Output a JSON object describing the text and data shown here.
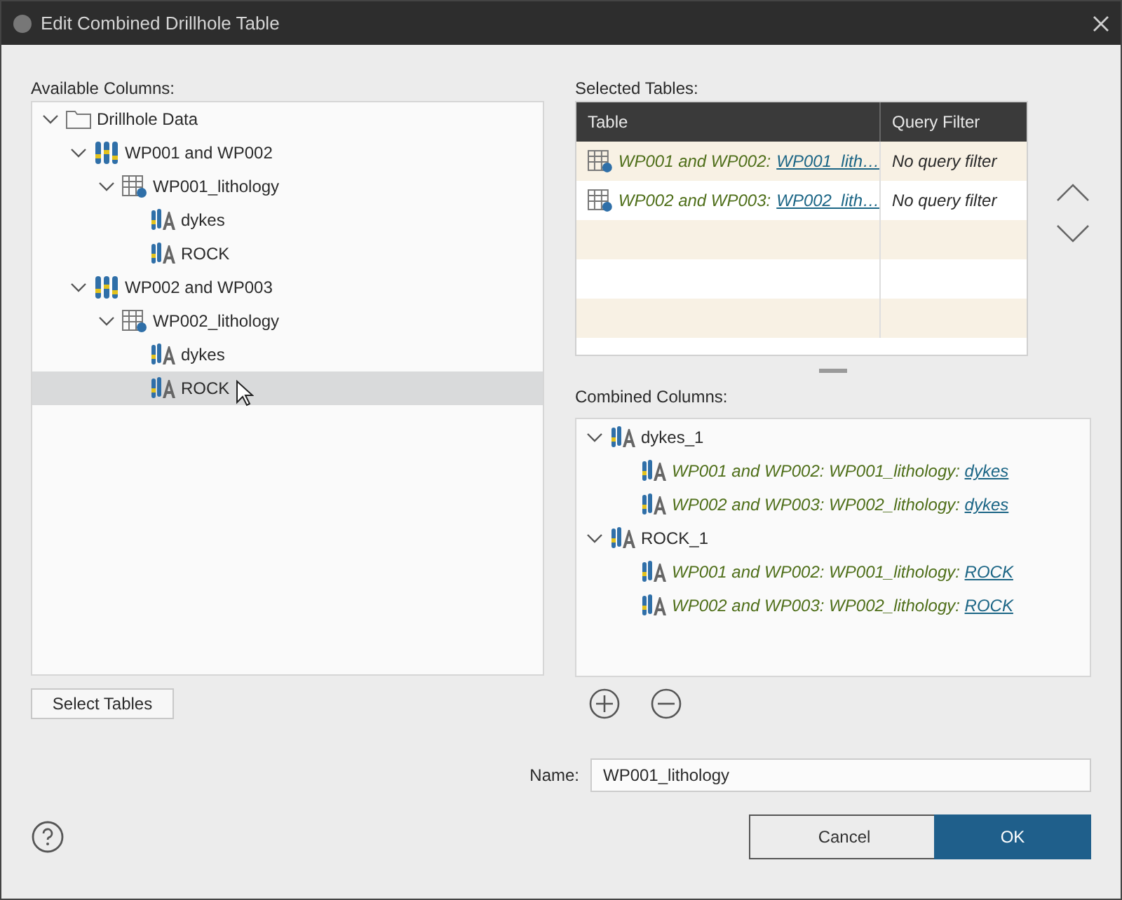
{
  "window": {
    "title": "Edit Combined Drillhole Table"
  },
  "available_columns": {
    "label": "Available Columns:",
    "tree": [
      {
        "kind": "folder",
        "label": "Drillhole Data",
        "expanded": true,
        "selected": false,
        "children": [
          {
            "kind": "drillholes",
            "label": "WP001 and WP002",
            "expanded": true,
            "selected": false,
            "children": [
              {
                "kind": "table",
                "label": "WP001_lithology",
                "expanded": true,
                "selected": false,
                "children": [
                  {
                    "kind": "column",
                    "label": "dykes",
                    "selected": false
                  },
                  {
                    "kind": "column",
                    "label": "ROCK",
                    "selected": false
                  }
                ]
              }
            ]
          },
          {
            "kind": "drillholes",
            "label": "WP002 and WP003",
            "expanded": true,
            "selected": false,
            "children": [
              {
                "kind": "table",
                "label": "WP002_lithology",
                "expanded": true,
                "selected": false,
                "children": [
                  {
                    "kind": "column",
                    "label": "dykes",
                    "selected": false
                  },
                  {
                    "kind": "column",
                    "label": "ROCK",
                    "selected": true
                  }
                ]
              }
            ]
          }
        ]
      }
    ]
  },
  "select_tables_button": "Select Tables",
  "selected_tables": {
    "label": "Selected Tables:",
    "columns": [
      "Table",
      "Query Filter"
    ],
    "rows": [
      {
        "source": "WP001 and WP002:",
        "link": "WP001_lith…",
        "filter": "No query filter"
      },
      {
        "source": "WP002 and WP003:",
        "link": "WP002_lith…",
        "filter": "No query filter"
      }
    ]
  },
  "combined_columns": {
    "label": "Combined Columns:",
    "tree": [
      {
        "label": "dykes_1",
        "expanded": true,
        "children": [
          {
            "path": "WP001 and WP002: WP001_lithology:",
            "link": "dykes"
          },
          {
            "path": "WP002 and WP003: WP002_lithology:",
            "link": "dykes"
          }
        ]
      },
      {
        "label": "ROCK_1",
        "expanded": true,
        "children": [
          {
            "path": "WP001 and WP002: WP001_lithology:",
            "link": "ROCK"
          },
          {
            "path": "WP002 and WP003: WP002_lithology:",
            "link": "ROCK"
          }
        ]
      }
    ]
  },
  "name": {
    "label": "Name:",
    "value": "WP001_lithology"
  },
  "buttons": [
    {
      "label": "Cancel",
      "kind": "secondary"
    },
    {
      "label": "OK",
      "kind": "primary"
    }
  ]
}
